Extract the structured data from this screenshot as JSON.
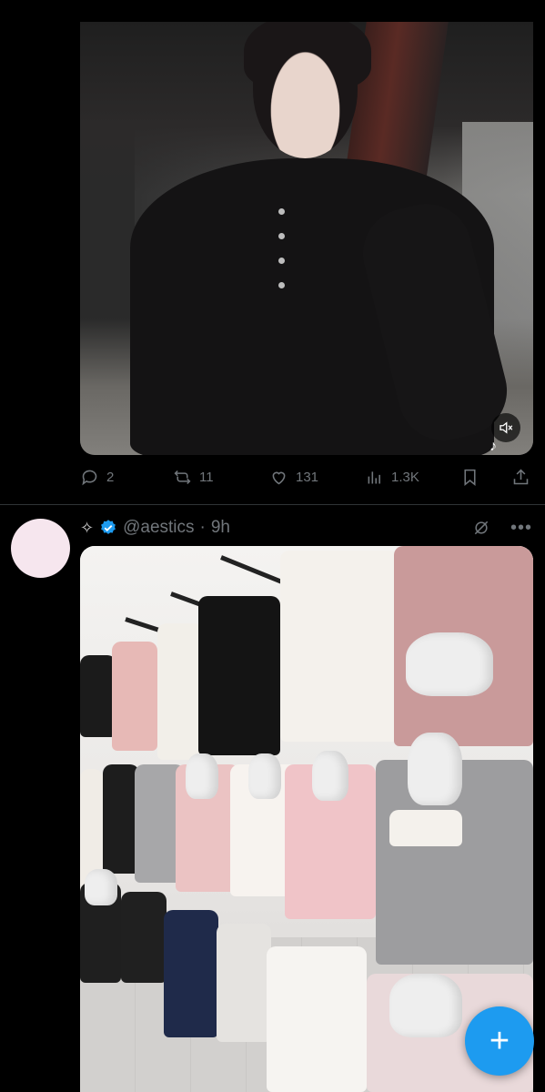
{
  "tweet1": {
    "replies": "2",
    "reposts": "11",
    "likes": "131",
    "views": "1.3K",
    "media": {
      "type": "video",
      "muted": true,
      "watermark_icon": "tiktok-icon"
    }
  },
  "tweet2": {
    "handle": "@aestics",
    "time": "9h",
    "separator": "·",
    "prefix_icon": "sparkle-icon",
    "verified": true,
    "media": {
      "type": "image"
    }
  },
  "colors": {
    "background": "#000000",
    "muted_text": "#71767b",
    "accent": "#1d9bf0",
    "avatar": "#f6e6ee"
  },
  "fab": {
    "icon": "plus-icon",
    "label": "+"
  }
}
